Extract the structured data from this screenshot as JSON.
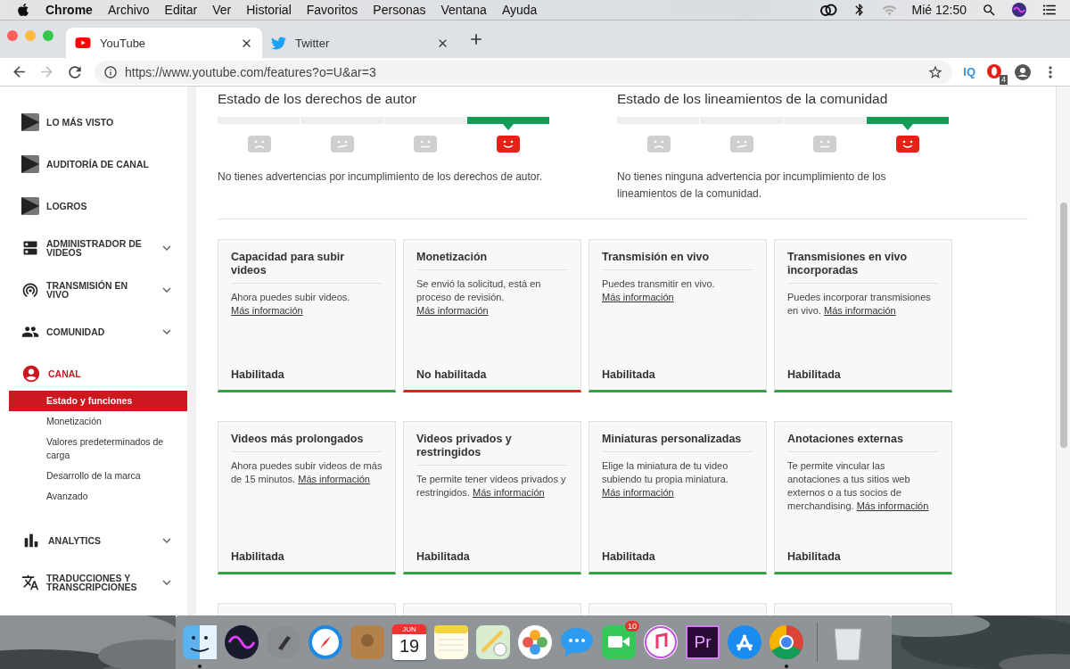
{
  "menu_bar": {
    "app": "Chrome",
    "menus": [
      "Archivo",
      "Editar",
      "Ver",
      "Historial",
      "Favoritos",
      "Personas",
      "Ventana",
      "Ayuda"
    ],
    "clock": "Mié 12:50"
  },
  "tabs": [
    {
      "title": "YouTube",
      "selected": true
    },
    {
      "title": "Twitter",
      "selected": false
    }
  ],
  "address_bar": {
    "url": "https://www.youtube.com/features?o=U&ar=3"
  },
  "toolbar": {
    "extension_label": "IQ",
    "extension_badge": "4"
  },
  "sidebar": {
    "items": [
      {
        "label": "LO MÁS VISTO",
        "expandable": false,
        "selected": false
      },
      {
        "label": "AUDITORÍA DE CANAL",
        "expandable": false,
        "selected": false
      },
      {
        "label": "LOGROS",
        "expandable": false,
        "selected": false
      },
      {
        "label": "ADMINISTRADOR DE VIDEOS",
        "expandable": true,
        "selected": false
      },
      {
        "label": "TRANSMISIÓN EN VIVO",
        "expandable": true,
        "selected": false
      },
      {
        "label": "COMUNIDAD",
        "expandable": true,
        "selected": false
      },
      {
        "label": "CANAL",
        "expandable": false,
        "selected": true,
        "children": [
          {
            "label": "Estado y funciones",
            "selected": true
          },
          {
            "label": "Monetización",
            "selected": false
          },
          {
            "label": "Valores predeterminados de carga",
            "selected": false
          },
          {
            "label": "Desarrollo de la marca",
            "selected": false
          },
          {
            "label": "Avanzado",
            "selected": false
          }
        ]
      },
      {
        "label": "ANALYTICS",
        "expandable": true,
        "selected": false
      },
      {
        "label": "TRADUCCIONES Y TRANSCRIPCIONES",
        "expandable": true,
        "selected": false
      }
    ]
  },
  "status_sections": [
    {
      "title": "Estado de los derechos de autor",
      "segments": [
        {
          "kind": "sad",
          "selected": false
        },
        {
          "kind": "meh",
          "selected": false
        },
        {
          "kind": "neutral",
          "selected": false
        },
        {
          "kind": "happy",
          "selected": true
        }
      ],
      "message": "No tienes advertencias por incumplimiento de los derechos de autor."
    },
    {
      "title": "Estado de los lineamientos de la comunidad",
      "segments": [
        {
          "kind": "sad",
          "selected": false
        },
        {
          "kind": "meh",
          "selected": false
        },
        {
          "kind": "neutral",
          "selected": false
        },
        {
          "kind": "happy",
          "selected": true
        }
      ],
      "message": "No tienes ninguna advertencia por incumplimiento de los lineamientos de la comunidad."
    }
  ],
  "cards": [
    {
      "kind": "feature",
      "title": "Capacidad para subir videos",
      "text": "Ahora puedes subir videos.",
      "link": "Más información",
      "status": "Habilitada",
      "enabled": true
    },
    {
      "kind": "feature",
      "title": "Monetización",
      "text": "Se envió la solicitud, está en proceso de revisión.",
      "link": "Más información",
      "status": "No habilitada",
      "enabled": false
    },
    {
      "kind": "feature",
      "title": "Transmisión en vivo",
      "text": "Puedes transmitir en vivo.",
      "link": "Más información",
      "status": "Habilitada",
      "enabled": true
    },
    {
      "kind": "feature",
      "title": "Transmisiones en vivo incorporadas",
      "text": "Puedes incorporar transmisiones en vivo.",
      "link": "Más información",
      "status": "Habilitada",
      "enabled": true
    },
    {
      "kind": "feature",
      "title": "Videos más prolongados",
      "text": "Ahora puedes subir videos de más de 15 minutos.",
      "link": "Más información",
      "status": "Habilitada",
      "enabled": true
    },
    {
      "kind": "feature",
      "title": "Videos privados y restringidos",
      "text": "Te permite tener videos privados y restringidos.",
      "link": "Más información",
      "status": "Habilitada",
      "enabled": true
    },
    {
      "kind": "feature",
      "title": "Miniaturas personalizadas",
      "text": "Elige la miniatura de tu video subiendo tu propia miniatura.",
      "link": "Más información",
      "status": "Habilitada",
      "enabled": true
    },
    {
      "kind": "feature",
      "title": "Anotaciones externas",
      "text": "Te permite vincular las anotaciones a tus sitios web externos o a tus socios de merchandising.",
      "link": "Más información",
      "status": "Habilitada",
      "enabled": true
    },
    {
      "kind": "cut"
    },
    {
      "kind": "cut"
    },
    {
      "kind": "cut"
    },
    {
      "kind": "cut"
    }
  ],
  "dock": {
    "items": [
      {
        "kind": "finder",
        "running": true
      },
      {
        "kind": "siri"
      },
      {
        "kind": "launchpad"
      },
      {
        "kind": "safari"
      },
      {
        "kind": "contacts"
      },
      {
        "kind": "calendar",
        "month": "JUN",
        "day": "19"
      },
      {
        "kind": "notes"
      },
      {
        "kind": "maps"
      },
      {
        "kind": "photos"
      },
      {
        "kind": "messages"
      },
      {
        "kind": "facetime",
        "badge": "10"
      },
      {
        "kind": "itunes"
      },
      {
        "kind": "premiere",
        "label": "Pr"
      },
      {
        "kind": "appstore"
      },
      {
        "kind": "chrome",
        "running": true
      },
      {
        "kind": "separator"
      },
      {
        "kind": "trash"
      }
    ]
  }
}
